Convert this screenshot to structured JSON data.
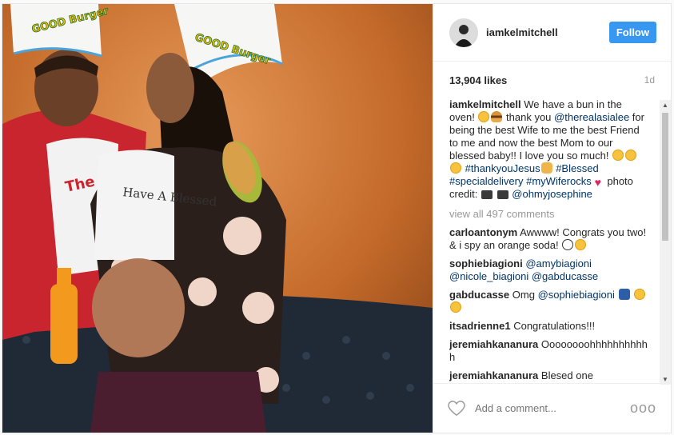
{
  "header": {
    "username": "iamkelmitchell",
    "follow_label": "Follow"
  },
  "meta": {
    "likes": "13,904 likes",
    "time_ago": "1d"
  },
  "caption": {
    "user": "iamkelmitchell",
    "t1": " We have a bun in the oven! ",
    "t2": " thank you ",
    "mention1": "@therealasialee",
    "t3": " for being the best Wife to me the best Friend to me and now the best Mom to our blessed baby!! I love you so much! ",
    "tag1": "#thankyouJesus",
    "tag2": "#Blessed",
    "tag3": "#specialdelivery",
    "tag4": "#myWiferocks",
    "t4": " photo credit: ",
    "mention2": "@ohmyjosephine"
  },
  "view_all": "view all 497 comments",
  "comments": [
    {
      "user": "carloantonym",
      "text": " Awwww! Congrats you two! & i spy an orange soda! "
    },
    {
      "user": "sophiebiagioni",
      "m1": "@amybiagioni",
      "m2": "@nicole_biagioni",
      "m3": "@gabducasse"
    },
    {
      "user": "gabducasse",
      "text": " Omg ",
      "m1": "@sophiebiagioni"
    },
    {
      "user": "itsadrienne1",
      "text": " Congratulations!!!"
    },
    {
      "user": "jeremiahkananura",
      "text": " Oooooooohhhhhhhhhhh"
    },
    {
      "user": "jeremiahkananura",
      "text": " Blesed one"
    }
  ],
  "footer": {
    "placeholder": "Add a comment...",
    "more": "ooo"
  },
  "photo": {
    "hat1": "GOOD Burger",
    "hat2": "GOOD Burger",
    "shirt": "Have A Blessed"
  },
  "colors": {
    "accent": "#3897f0",
    "link": "#003569",
    "wall": "#c9702a"
  }
}
